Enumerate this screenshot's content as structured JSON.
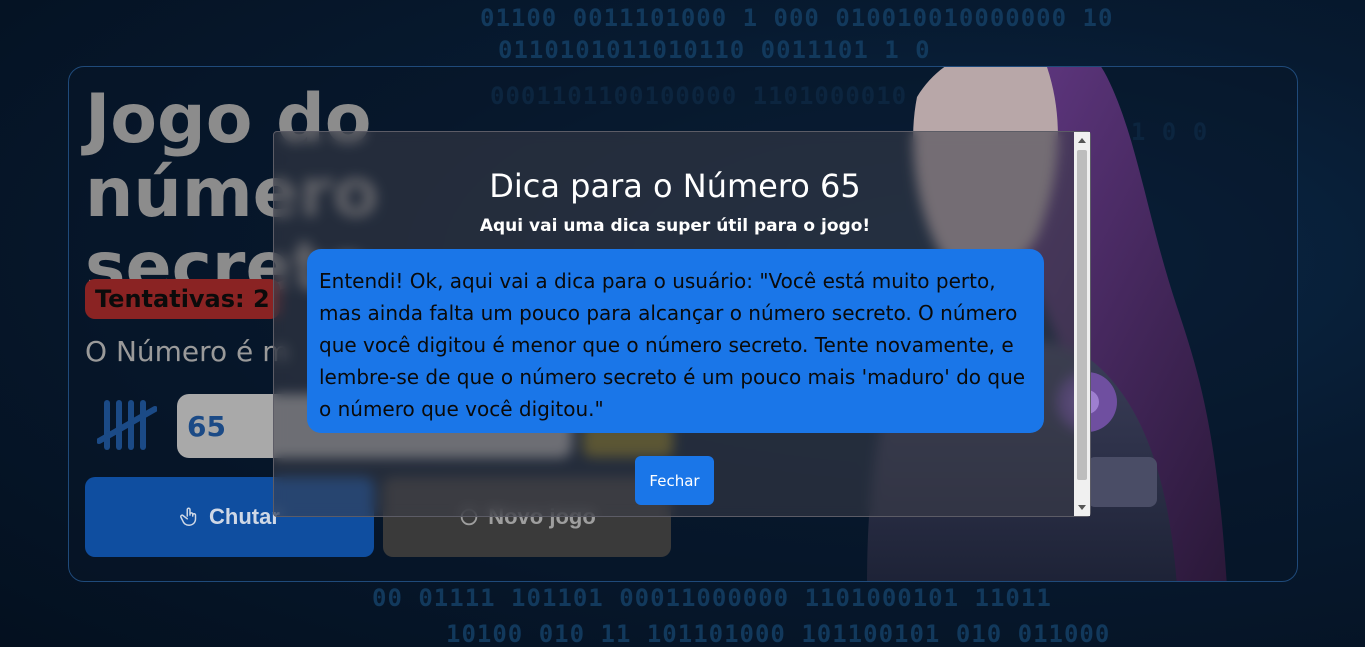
{
  "background": {
    "binary_lines": [
      "01100 0011101000 1    000 010010010000000 10",
      "0110101011010110                  0011101 1 0",
      "0001101100100000                  1101000010",
      "                                    011 0 0",
      "00 01111   101101 00011000000 1101000101 11011",
      "10100 010 11 101101000 101100101 010 011000"
    ]
  },
  "game": {
    "title": "Jogo do número secreto",
    "attempts_label": "Tentativas: 2",
    "status_text": "O Número é m",
    "input_value": "65",
    "guess_button": "Chutar",
    "new_game_button": "Novo jogo"
  },
  "modal": {
    "title": "Dica para o Número 65",
    "subtitle": "Aqui vai uma dica super útil para o jogo!",
    "hint": "Entendi! Ok, aqui vai a dica para o usuário: \"Você está muito perto, mas ainda falta um pouco para alcançar o número secreto. O número que você digitou é menor que o número secreto. Tente novamente, e lembre-se de que o número secreto é um pouco mais 'maduro' do que o número que você digitou.\"",
    "close_button": "Fechar"
  },
  "colors": {
    "accent": "#1a76e8",
    "attempts_badge": "#8a2323",
    "guess_button": "#0f4ea0",
    "background": "#071a30"
  }
}
